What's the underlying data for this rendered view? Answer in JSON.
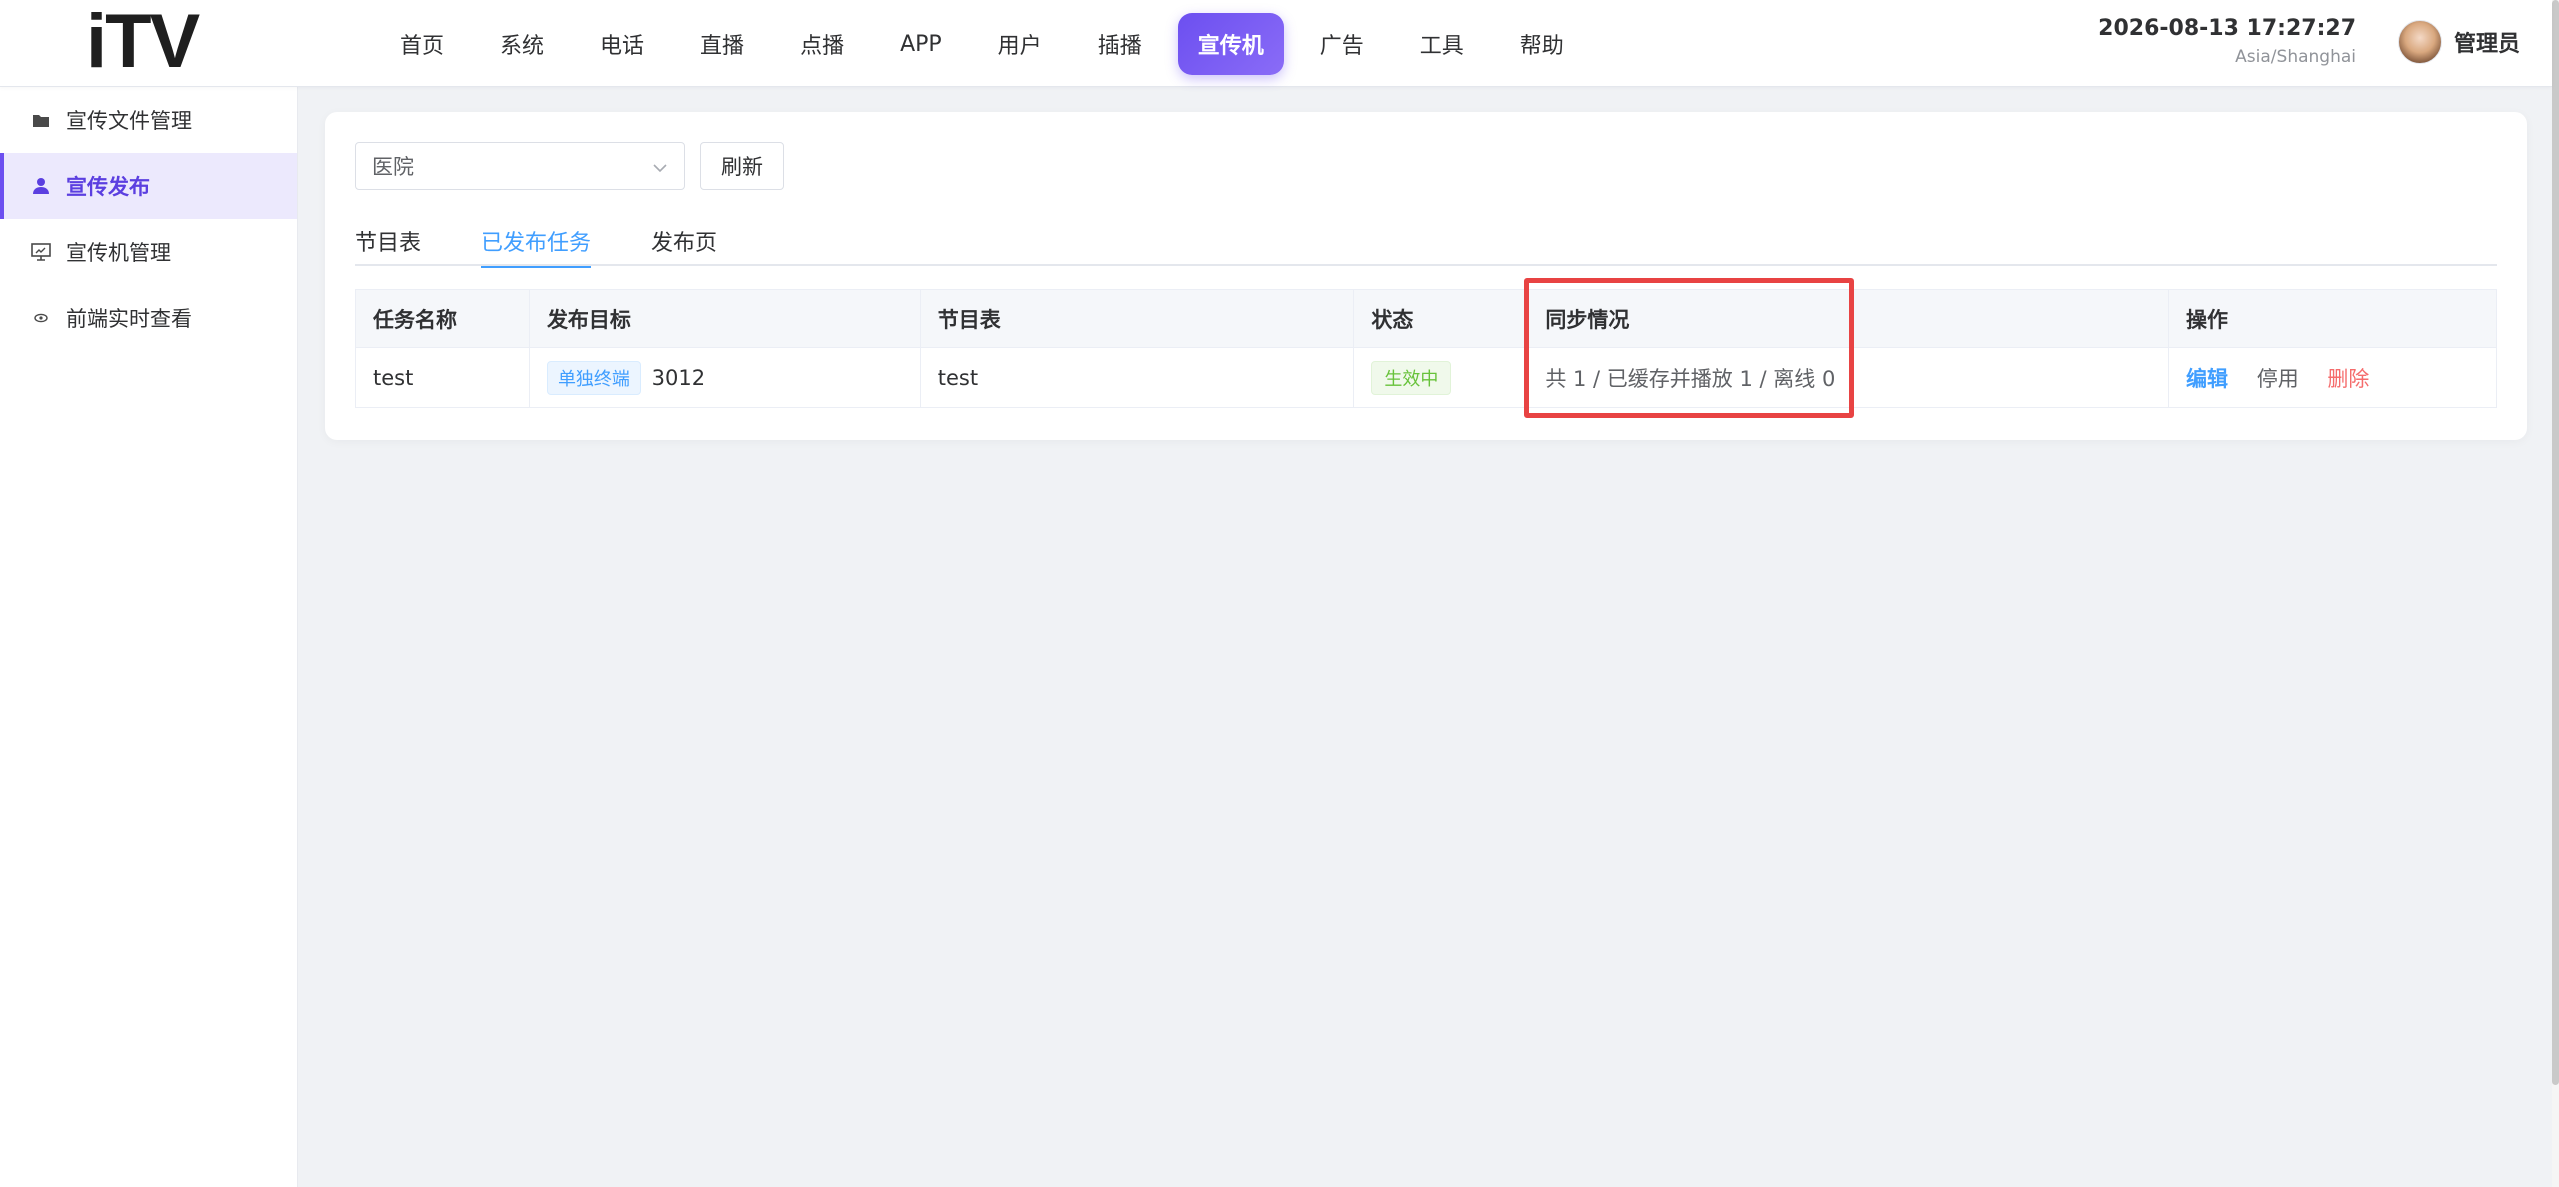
{
  "brand": {
    "logo_text": "iTV"
  },
  "nav": {
    "items": [
      {
        "label": "首页"
      },
      {
        "label": "系统"
      },
      {
        "label": "电话"
      },
      {
        "label": "直播"
      },
      {
        "label": "点播"
      },
      {
        "label": "APP"
      },
      {
        "label": "用户"
      },
      {
        "label": "插播"
      },
      {
        "label": "宣传机",
        "active": true
      },
      {
        "label": "广告"
      },
      {
        "label": "工具"
      },
      {
        "label": "帮助"
      }
    ]
  },
  "header": {
    "datetime": "2026-08-13 17:27:27",
    "timezone": "Asia/Shanghai",
    "user_name": "管理员"
  },
  "sidebar": {
    "items": [
      {
        "label": "宣传文件管理",
        "icon": "folder-icon"
      },
      {
        "label": "宣传发布",
        "icon": "user-icon",
        "active": true
      },
      {
        "label": "宣传机管理",
        "icon": "monitor-icon"
      },
      {
        "label": "前端实时查看",
        "icon": "eye-icon"
      }
    ]
  },
  "toolbar": {
    "select_value": "医院",
    "refresh_label": "刷新"
  },
  "tabs": [
    {
      "label": "节目表"
    },
    {
      "label": "已发布任务",
      "active": true
    },
    {
      "label": "发布页"
    }
  ],
  "table": {
    "headers": [
      "任务名称",
      "发布目标",
      "节目表",
      "状态",
      "同步情况",
      "操作"
    ],
    "rows": [
      {
        "name": "test",
        "target_tag": "单独终端",
        "target_value": "3012",
        "program": "test",
        "status": "生效中",
        "sync": "共 1 / 已缓存并播放 1 / 离线 0",
        "actions": {
          "edit": "编辑",
          "stop": "停用",
          "delete": "删除"
        }
      }
    ]
  },
  "colors": {
    "accent": "#6c4ff0",
    "link": "#409eff",
    "danger": "#f56c6c",
    "success": "#67c23a",
    "highlight": "#e84343"
  }
}
